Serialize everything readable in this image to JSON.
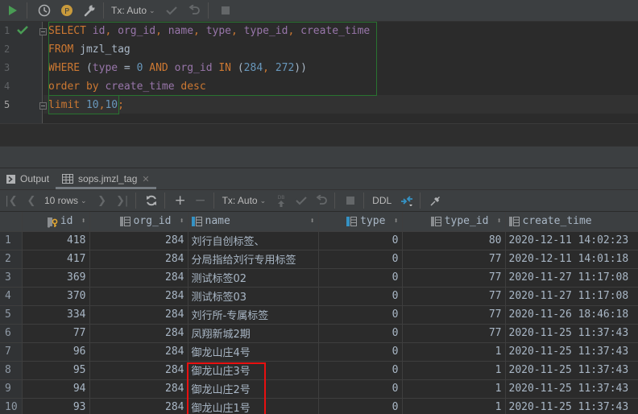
{
  "toolbar": {
    "run_icon": "run-icon",
    "history_icon": "history-icon",
    "profile_badge": "P",
    "settings_icon": "wrench-icon",
    "tx_mode": "Tx: Auto",
    "commit_icon": "check-icon",
    "rollback_icon": "undo-icon",
    "stop_icon": "stop-icon"
  },
  "editor": {
    "line_numbers": [
      "1",
      "2",
      "3",
      "4",
      "5"
    ],
    "current_line": 5,
    "status": "executed-ok",
    "lines": [
      [
        {
          "t": "SELECT",
          "c": "kw"
        },
        {
          "t": " ",
          "c": "plain"
        },
        {
          "t": "id",
          "c": "col"
        },
        {
          "t": ", ",
          "c": "kw"
        },
        {
          "t": "org_id",
          "c": "col"
        },
        {
          "t": ", ",
          "c": "kw"
        },
        {
          "t": "name",
          "c": "col"
        },
        {
          "t": ", ",
          "c": "kw"
        },
        {
          "t": "type",
          "c": "col"
        },
        {
          "t": ", ",
          "c": "kw"
        },
        {
          "t": "type_id",
          "c": "col"
        },
        {
          "t": ", ",
          "c": "kw"
        },
        {
          "t": "create_time",
          "c": "col"
        }
      ],
      [
        {
          "t": "FROM",
          "c": "kw"
        },
        {
          "t": " jmzl_tag",
          "c": "plain"
        }
      ],
      [
        {
          "t": "WHERE",
          "c": "kw"
        },
        {
          "t": " (",
          "c": "plain"
        },
        {
          "t": "type",
          "c": "col"
        },
        {
          "t": " = ",
          "c": "plain"
        },
        {
          "t": "0",
          "c": "num"
        },
        {
          "t": " AND ",
          "c": "kw"
        },
        {
          "t": "org_id",
          "c": "col"
        },
        {
          "t": " IN ",
          "c": "kw"
        },
        {
          "t": "(",
          "c": "plain"
        },
        {
          "t": "284",
          "c": "num"
        },
        {
          "t": ", ",
          "c": "kw"
        },
        {
          "t": "272",
          "c": "num"
        },
        {
          "t": "))",
          "c": "plain"
        }
      ],
      [
        {
          "t": "order by",
          "c": "kw"
        },
        {
          "t": " ",
          "c": "plain"
        },
        {
          "t": "create_time",
          "c": "col"
        },
        {
          "t": " desc",
          "c": "kw"
        }
      ],
      [
        {
          "t": "limit",
          "c": "kw"
        },
        {
          "t": " ",
          "c": "plain"
        },
        {
          "t": "10",
          "c": "num"
        },
        {
          "t": ",",
          "c": "kw"
        },
        {
          "t": "10",
          "c": "num"
        },
        {
          "t": ";",
          "c": "kw"
        }
      ]
    ]
  },
  "tabs": [
    {
      "label": "Output",
      "icon": "console-icon",
      "active": false
    },
    {
      "label": "sops.jmzl_tag",
      "icon": "table-icon",
      "active": true,
      "closable": true
    }
  ],
  "result_toolbar": {
    "page_size": "10 rows",
    "tx_mode": "Tx: Auto",
    "ddl_label": "DDL"
  },
  "grid": {
    "columns": [
      {
        "label": "id",
        "icon": "primary-key-icon",
        "sortable": true
      },
      {
        "label": "org_id",
        "icon": "column-icon",
        "sortable": true
      },
      {
        "label": "name",
        "icon": "column-icon",
        "sortable": true
      },
      {
        "label": "type",
        "icon": "column-icon",
        "sortable": true
      },
      {
        "label": "type_id",
        "icon": "column-icon",
        "sortable": true
      },
      {
        "label": "create_time",
        "icon": "column-icon",
        "sortable": false
      }
    ],
    "rows": [
      {
        "n": "1",
        "id": "418",
        "org_id": "284",
        "name": "刘行自创标签、",
        "type": "0",
        "type_id": "80",
        "create_time": "2020-12-11 14:02:23"
      },
      {
        "n": "2",
        "id": "417",
        "org_id": "284",
        "name": "分局指给刘行专用标签",
        "type": "0",
        "type_id": "77",
        "create_time": "2020-12-11 14:01:18"
      },
      {
        "n": "3",
        "id": "369",
        "org_id": "284",
        "name": "测试标签02",
        "type": "0",
        "type_id": "77",
        "create_time": "2020-11-27 11:17:08"
      },
      {
        "n": "4",
        "id": "370",
        "org_id": "284",
        "name": "测试标签03",
        "type": "0",
        "type_id": "77",
        "create_time": "2020-11-27 11:17:08"
      },
      {
        "n": "5",
        "id": "334",
        "org_id": "284",
        "name": "刘行所-专属标签",
        "type": "0",
        "type_id": "77",
        "create_time": "2020-11-26 18:46:18"
      },
      {
        "n": "6",
        "id": "77",
        "org_id": "284",
        "name": "凤翔新城2期",
        "type": "0",
        "type_id": "77",
        "create_time": "2020-11-25 11:37:43"
      },
      {
        "n": "7",
        "id": "96",
        "org_id": "284",
        "name": "御龙山庄4号",
        "type": "0",
        "type_id": "1",
        "create_time": "2020-11-25 11:37:43"
      },
      {
        "n": "8",
        "id": "95",
        "org_id": "284",
        "name": "御龙山庄3号",
        "type": "0",
        "type_id": "1",
        "create_time": "2020-11-25 11:37:43"
      },
      {
        "n": "9",
        "id": "94",
        "org_id": "284",
        "name": "御龙山庄2号",
        "type": "0",
        "type_id": "1",
        "create_time": "2020-11-25 11:37:43"
      },
      {
        "n": "10",
        "id": "93",
        "org_id": "284",
        "name": "御龙山庄1号",
        "type": "0",
        "type_id": "1",
        "create_time": "2020-11-25 11:37:43"
      }
    ],
    "highlighted_rows": [
      "8",
      "9",
      "10"
    ],
    "highlight_color": "#e81010"
  }
}
